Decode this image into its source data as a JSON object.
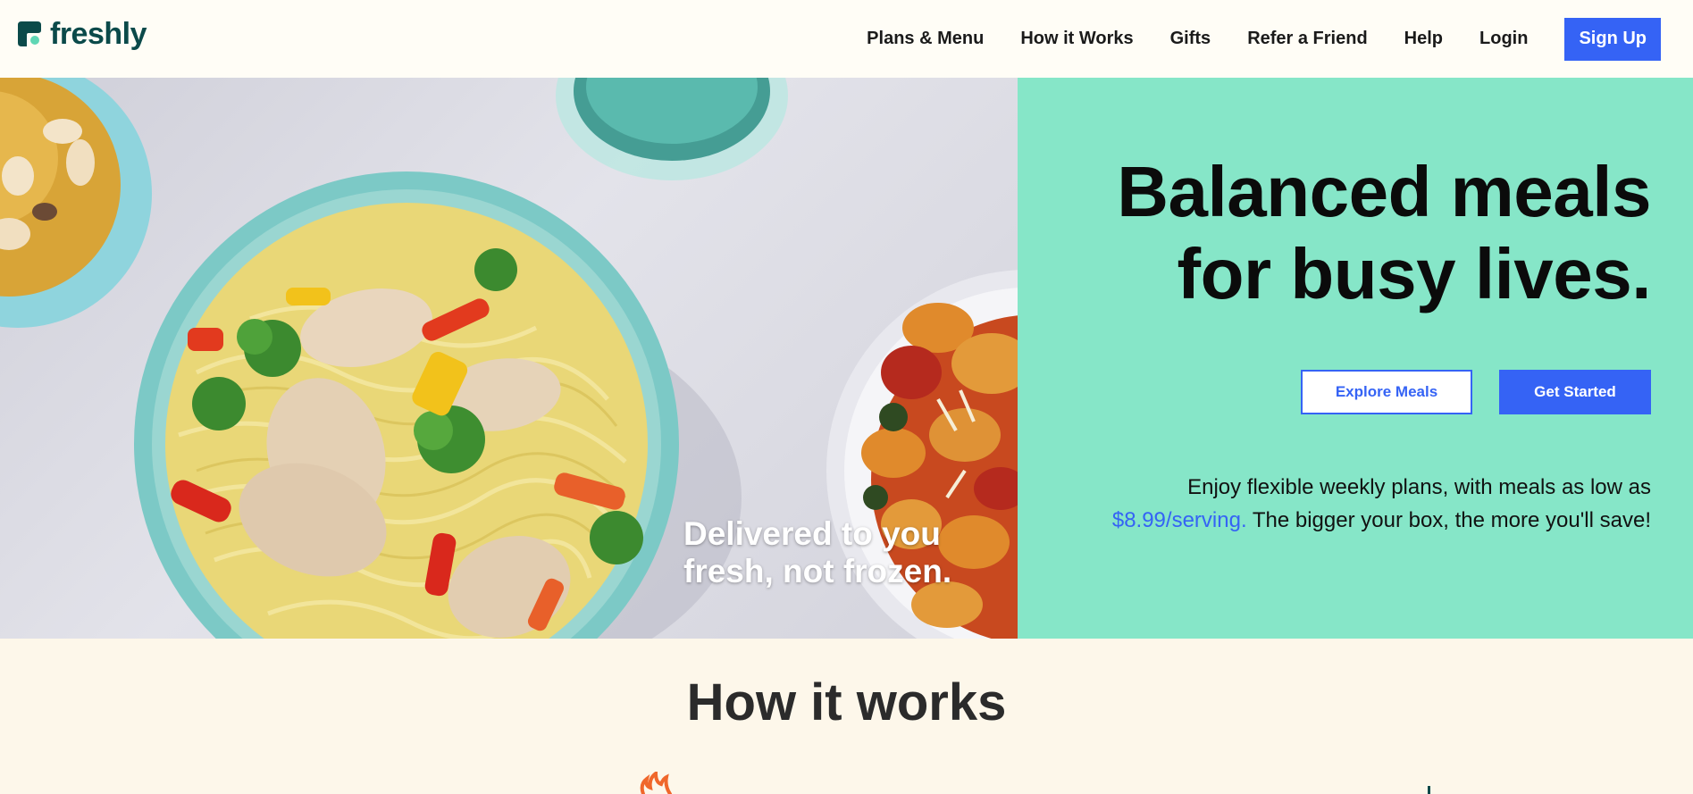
{
  "header": {
    "logo_text": "freshly",
    "nav": {
      "plans_menu": "Plans & Menu",
      "how_it_works": "How it Works",
      "gifts": "Gifts",
      "refer": "Refer a Friend",
      "help": "Help",
      "login": "Login"
    },
    "signup_label": "Sign Up"
  },
  "hero": {
    "caption_line1": "Delivered to you",
    "caption_line2": "fresh, not frozen.",
    "title_line1": "Balanced meals",
    "title_line2": "for busy lives.",
    "explore_label": "Explore Meals",
    "get_started_label": "Get Started",
    "sub_part1": "Enjoy flexible weekly plans, with meals as low as",
    "price": "$8.99/serving.",
    "sub_part2": " The bigger your box, the more you'll save!"
  },
  "how_it_works": {
    "title": "How it works"
  },
  "colors": {
    "brand_green": "#0b4a4a",
    "accent_blue": "#3563f5",
    "hero_mint": "#86e6c8",
    "page_cream": "#fdf7ea",
    "header_bg": "#fffdf6"
  },
  "icons": {
    "logo": "freshly-logo-icon",
    "steam": "flame-icon"
  }
}
